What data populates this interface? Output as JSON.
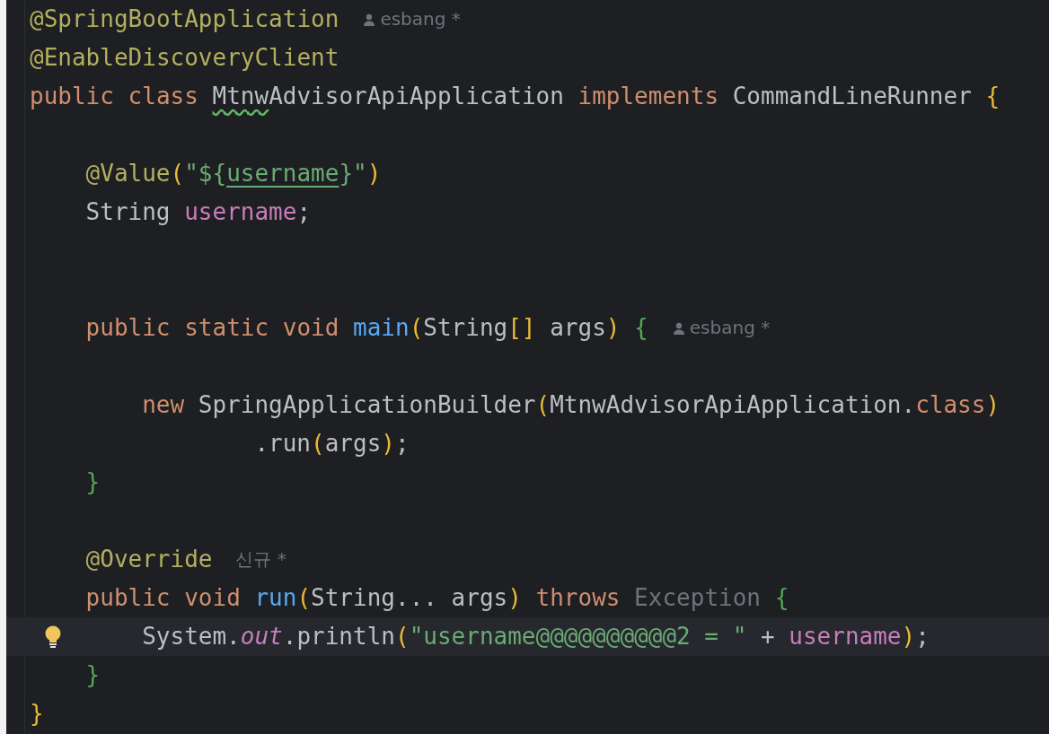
{
  "editor": {
    "lines": [
      {
        "current": false,
        "lightbulb": false,
        "tokens": [
          {
            "kind": "annotation",
            "text": "@SpringBootApplication"
          },
          {
            "kind": "hint",
            "user": true,
            "text": "esbang *"
          }
        ]
      },
      {
        "current": false,
        "lightbulb": false,
        "tokens": [
          {
            "kind": "annotation",
            "text": "@EnableDiscoveryClient"
          }
        ]
      },
      {
        "current": false,
        "lightbulb": false,
        "tokens": [
          {
            "kind": "keyword",
            "text": "public class "
          },
          {
            "kind": "typo",
            "text": "Mtnw"
          },
          {
            "kind": "plain",
            "text": "AdvisorApiApplication "
          },
          {
            "kind": "keyword",
            "text": "implements "
          },
          {
            "kind": "plain",
            "text": "CommandLineRunner "
          },
          {
            "kind": "bracket",
            "text": "{"
          }
        ],
        "children": [
          {
            "current": false,
            "lightbulb": false
          },
          {
            "current": false,
            "lightbulb": false,
            "tokens": [
              {
                "kind": "annotation",
                "text": "@Value"
              },
              {
                "kind": "bracket",
                "text": "("
              },
              {
                "kind": "string",
                "text": "\"${"
              },
              {
                "kind": "reference",
                "text": "username"
              },
              {
                "kind": "string",
                "text": "}\""
              },
              {
                "kind": "bracket",
                "text": ")"
              }
            ]
          },
          {
            "current": false,
            "lightbulb": false,
            "tokens": [
              {
                "kind": "plain",
                "text": "String "
              },
              {
                "kind": "field",
                "text": "username"
              },
              {
                "kind": "plain",
                "text": ";"
              }
            ]
          },
          {
            "current": false,
            "lightbulb": false
          },
          {
            "current": false,
            "lightbulb": false
          },
          {
            "current": false,
            "lightbulb": false,
            "tokens": [
              {
                "kind": "keyword",
                "text": "public static void "
              },
              {
                "kind": "method",
                "text": "main"
              },
              {
                "kind": "bracket",
                "text": "("
              },
              {
                "kind": "plain",
                "text": "String"
              },
              {
                "kind": "bracket",
                "text": "[]"
              },
              {
                "kind": "plain",
                "text": " args"
              },
              {
                "kind": "bracket",
                "text": ")"
              },
              {
                "kind": "brace",
                "text": " {"
              },
              {
                "kind": "hint",
                "user": true,
                "text": "esbang *"
              }
            ],
            "children": [
              {
                "current": false,
                "lightbulb": false
              },
              {
                "current": false,
                "lightbulb": false,
                "tokens": [
                  {
                    "kind": "keyword",
                    "text": "new "
                  },
                  {
                    "kind": "plain",
                    "text": "SpringApplicationBuilder"
                  },
                  {
                    "kind": "bracket",
                    "text": "("
                  },
                  {
                    "kind": "plain",
                    "text": "MtnwAdvisorApiApplication."
                  },
                  {
                    "kind": "keyword",
                    "text": "class"
                  },
                  {
                    "kind": "bracket",
                    "text": ")"
                  }
                ],
                "children": [
                  {
                    "current": false,
                    "lightbulb": false,
                    "continuation": true,
                    "tokens": [
                      {
                        "kind": "plain",
                        "text": ".run"
                      },
                      {
                        "kind": "bracket",
                        "text": "("
                      },
                      {
                        "kind": "plain",
                        "text": "args"
                      },
                      {
                        "kind": "bracket",
                        "text": ")"
                      },
                      {
                        "kind": "plain",
                        "text": ";"
                      }
                    ]
                  }
                ]
              }
            ]
          },
          {
            "current": false,
            "lightbulb": false,
            "tokens": [
              {
                "kind": "brace",
                "text": "}"
              }
            ]
          },
          {
            "current": false,
            "lightbulb": false
          },
          {
            "current": false,
            "lightbulb": false,
            "tokens": [
              {
                "kind": "annotation",
                "text": "@Override"
              },
              {
                "kind": "hint",
                "user": false,
                "text": "신규 *"
              }
            ]
          },
          {
            "current": false,
            "lightbulb": false,
            "tokens": [
              {
                "kind": "keyword",
                "text": "public void "
              },
              {
                "kind": "method",
                "text": "run"
              },
              {
                "kind": "bracket",
                "text": "("
              },
              {
                "kind": "plain",
                "text": "String... args"
              },
              {
                "kind": "bracket",
                "text": ")"
              },
              {
                "kind": "keyword",
                "text": " throws "
              },
              {
                "kind": "unused",
                "text": "Exception "
              },
              {
                "kind": "brace",
                "text": "{"
              }
            ],
            "children": [
              {
                "current": true,
                "lightbulb": true,
                "tokens": [
                  {
                    "kind": "plain",
                    "text": "System."
                  },
                  {
                    "kind": "static",
                    "text": "out"
                  },
                  {
                    "kind": "plain",
                    "text": ".println"
                  },
                  {
                    "kind": "bracket",
                    "text": "("
                  },
                  {
                    "kind": "string",
                    "text": "\"username@@@@@@@@@@2 = \""
                  },
                  {
                    "kind": "plain",
                    "text": " + "
                  },
                  {
                    "kind": "field",
                    "text": "username"
                  },
                  {
                    "kind": "bracket",
                    "text": ")"
                  },
                  {
                    "kind": "plain",
                    "text": ";"
                  }
                ]
              }
            ]
          },
          {
            "current": false,
            "lightbulb": false,
            "tokens": [
              {
                "kind": "brace",
                "text": "}"
              }
            ]
          }
        ]
      },
      {
        "current": false,
        "lightbulb": false,
        "tokens": [
          {
            "kind": "bracket",
            "text": "}"
          }
        ]
      }
    ]
  }
}
